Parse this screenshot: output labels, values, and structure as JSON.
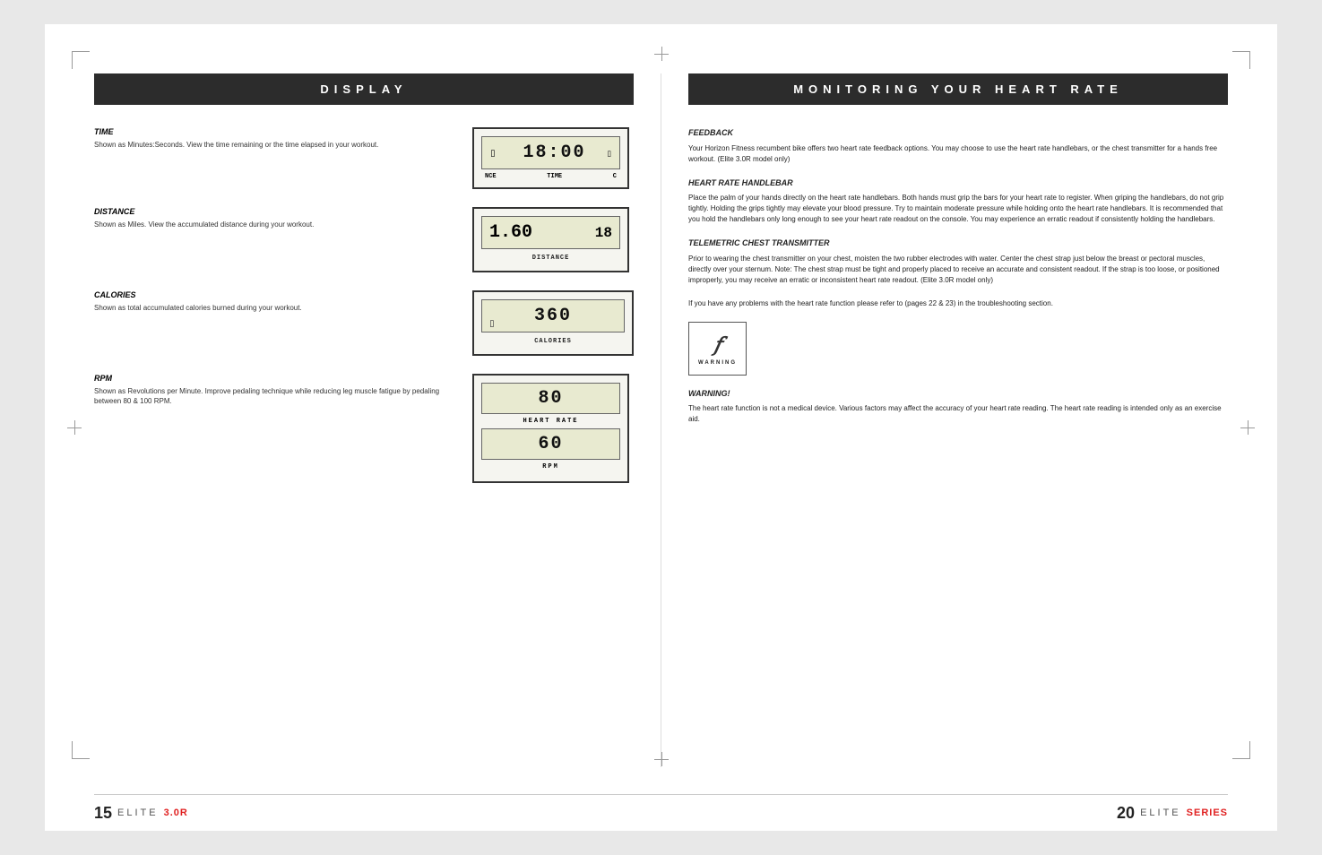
{
  "left": {
    "header": "DISPLAY",
    "items": [
      {
        "name": "time",
        "label": "TIME",
        "description": "Shown as Minutes:Seconds. View the time remaining or the time elapsed in your workout.",
        "display": {
          "digits": "18:00",
          "labels": [
            "NCE",
            "TIME",
            "C"
          ]
        }
      },
      {
        "name": "distance",
        "label": "DISTANCE",
        "description": "Shown as Miles. View the accumulated distance during your workout.",
        "display": {
          "digits": "1.60",
          "side_num": "18",
          "label": "DISTANCE"
        }
      },
      {
        "name": "calories",
        "label": "CALORIES",
        "description": "Shown as total accumulated calories burned during your workout.",
        "display": {
          "digits": "360",
          "label": "CALORIES"
        }
      },
      {
        "name": "rpm",
        "label": "RPM",
        "description": "Shown as Revolutions per Minute. Improve pedaling technique while reducing leg muscle fatigue by pedaling between 80 & 100 RPM.",
        "display": {
          "hr_digits": "80",
          "hr_label": "HEART RATE",
          "rpm_digits": "60",
          "rpm_label": "RPM"
        }
      }
    ],
    "footer_page": "15",
    "footer_series": "ELITE",
    "footer_model": "3.0R"
  },
  "right": {
    "header": "MONITORING YOUR HEART RATE",
    "sections": [
      {
        "id": "feedback",
        "title": "FEEDBACK",
        "text": "Your Horizon Fitness recumbent bike offers two heart rate feedback options. You may choose to use the heart rate handlebars, or the chest transmitter for a hands free workout. (Elite 3.0R model only)"
      },
      {
        "id": "handlebar",
        "title": "HEART RATE HANDLEBAR",
        "text": "Place the palm of your hands directly on the heart rate handlebars. Both hands must grip the bars for your heart rate to register. When griping the handlebars, do not grip tightly. Holding the grips tightly may elevate your blood pressure. Try to maintain moderate pressure while holding onto the heart rate handlebars. It is recommended that you hold the handlebars only long enough to see your heart rate readout on the console. You may experience an erratic readout if consistently holding the handlebars."
      },
      {
        "id": "transmitter",
        "title": "TELEMETRIC CHEST TRANSMITTER",
        "text": "Prior to wearing the chest transmitter on your chest, moisten the two rubber electrodes with water. Center the chest strap just below the breast or pectoral muscles, directly over your sternum. Note: The chest strap must be tight and properly placed to receive an accurate and consistent readout. If the strap is too loose, or positioned improperly, you may receive an erratic or inconsistent heart rate readout. (Elite 3.0R model only)"
      },
      {
        "id": "troubleshoot",
        "text": "If you have any problems with the heart rate function please refer to (pages 22 & 23) in the troubleshooting section."
      }
    ],
    "warning": {
      "icon_label": "WARNING",
      "title": "WARNING!",
      "text": "The heart rate function is not a medical device. Various factors may affect the accuracy of your heart rate reading. The heart rate reading is intended only as an exercise aid."
    },
    "footer_page": "20",
    "footer_series": "ELITE",
    "footer_model": "SERIES"
  }
}
